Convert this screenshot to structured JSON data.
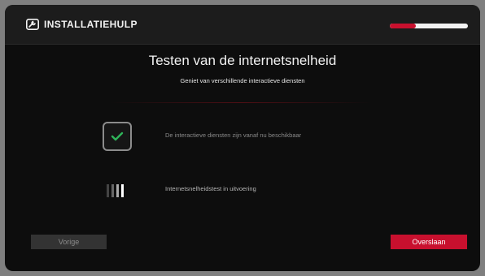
{
  "header": {
    "title": "INSTALLATIEHULP",
    "progress_fraction": 0.33,
    "accent_color": "#c8102e",
    "logo_icon": "wrench-icon"
  },
  "main": {
    "title": "Testen van de internetsnelheid",
    "subtitle": "Geniet van verschillende interactieve diensten"
  },
  "steps": [
    {
      "icon": "checkmark-icon",
      "text": "De interactieve diensten zijn vanaf nu beschikbaar",
      "status": "done"
    },
    {
      "icon": "loading-bars-icon",
      "text": "Internetsnelheidstest in uitvoering",
      "status": "in-progress"
    }
  ],
  "footer": {
    "prev_label": "Vorige",
    "skip_label": "Overslaan"
  }
}
